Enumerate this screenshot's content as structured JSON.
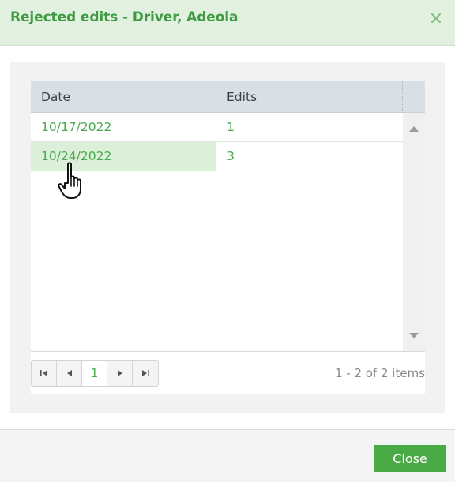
{
  "dialog": {
    "title": "Rejected edits - Driver, Adeola",
    "close_icon": "close-icon"
  },
  "grid": {
    "columns": [
      "Date",
      "Edits"
    ],
    "rows": [
      {
        "date": "10/17/2022",
        "edits": "1"
      },
      {
        "date": "10/24/2022",
        "edits": "3"
      }
    ],
    "selected_row": 1
  },
  "pager": {
    "current_page": "1",
    "info": "1 - 2 of 2 items"
  },
  "footer": {
    "close_label": "Close"
  },
  "colors": {
    "accent": "#4aa84f",
    "header_bg": "#e2f1df",
    "grid_header_bg": "#d8e0e5",
    "selected_cell_bg": "#dcefd8"
  }
}
